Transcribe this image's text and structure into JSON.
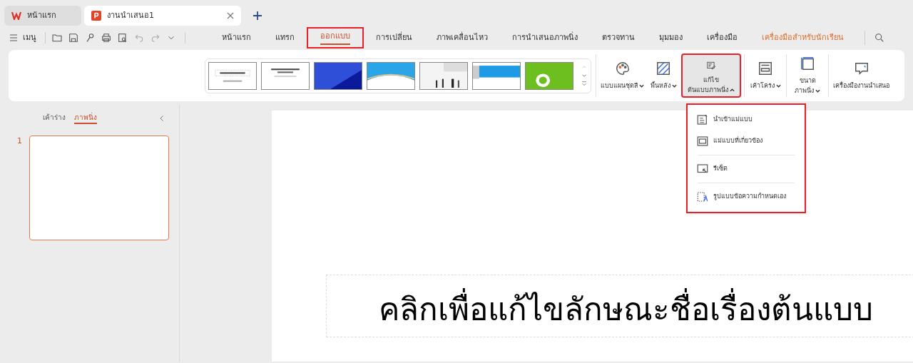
{
  "doc_tabs": [
    {
      "kind": "home",
      "label": "หน้าแรก",
      "selected": false
    },
    {
      "kind": "doc",
      "label": "งานนำเสนอ1",
      "selected": true
    }
  ],
  "menu_label": "เมนู",
  "ribbon_tabs": [
    {
      "label": "หน้าแรก",
      "selected": false,
      "accent": false
    },
    {
      "label": "แทรก",
      "selected": false,
      "accent": false
    },
    {
      "label": "ออกแบบ",
      "selected": true,
      "accent": false
    },
    {
      "label": "การเปลี่ยน",
      "selected": false,
      "accent": false
    },
    {
      "label": "ภาพเคลื่อนไหว",
      "selected": false,
      "accent": false
    },
    {
      "label": "การนำเสนอภาพนิ่ง",
      "selected": false,
      "accent": false
    },
    {
      "label": "ตรวจทาน",
      "selected": false,
      "accent": false
    },
    {
      "label": "มุมมอง",
      "selected": false,
      "accent": false
    },
    {
      "label": "เครื่องมือ",
      "selected": false,
      "accent": false
    },
    {
      "label": "เครื่องมือสำหรับนักเรียน",
      "selected": false,
      "accent": true
    }
  ],
  "designs": [
    {
      "kind": "text"
    },
    {
      "kind": "text2"
    },
    {
      "kind": "blue"
    },
    {
      "kind": "wave"
    },
    {
      "kind": "people"
    },
    {
      "kind": "banner"
    },
    {
      "kind": "green"
    }
  ],
  "ribbon_buttons": [
    {
      "kind": "palette",
      "lines": [
        "แบบแผนชุดสี"
      ],
      "dropdown": true,
      "expanded": false
    },
    {
      "kind": "background",
      "lines": [
        "พื้นหลัง"
      ],
      "dropdown": true,
      "expanded": false
    },
    {
      "kind": "master",
      "lines": [
        "แก้ไข",
        "ต้นแบบภาพนิ่ง"
      ],
      "dropdown": true,
      "expanded": true
    },
    {
      "kind": "layout",
      "lines": [
        "เค้าโครง"
      ],
      "dropdown": true,
      "expanded": false
    },
    {
      "kind": "size",
      "lines": [
        "ขนาด",
        "ภาพนิ่ง"
      ],
      "dropdown": true,
      "expanded": false
    },
    {
      "kind": "tools",
      "lines": [
        "เครื่องมืองานนำเสนอ"
      ],
      "dropdown": false,
      "expanded": false
    }
  ],
  "panel_tabs": [
    {
      "label": "เค้าร่าง",
      "selected": false
    },
    {
      "label": "ภาพนิ่ง",
      "selected": true
    }
  ],
  "slides": [
    {
      "number": "1",
      "selected": true
    }
  ],
  "dropdown": [
    {
      "kind": "import",
      "label": "นำเข้าแม่แบบ"
    },
    {
      "kind": "related",
      "label": "แม่แบบที่เกี่ยวข้อง"
    },
    {
      "kind": "reset",
      "label": "รีเซ็ต"
    },
    {
      "kind": "custom",
      "label": "รูปแบบข้อความกำหนดเอง"
    }
  ],
  "slide_title": "คลิกเพื่อแก้ไขลักษณะชื่อเรื่องต้นแบบ"
}
